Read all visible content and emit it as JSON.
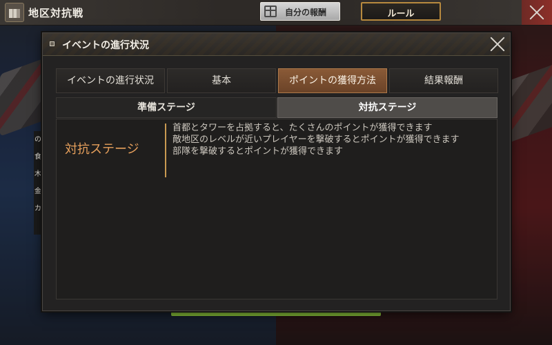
{
  "topbar": {
    "title": "地区対抗戦",
    "reward_button": "自分の報酬",
    "rule_button": "ルール",
    "icons": {
      "event": "building-icon",
      "gift": "gift-icon",
      "close": "close-icon"
    }
  },
  "background": {
    "side_labels": [
      "の",
      "食",
      "木",
      "金",
      "カ"
    ]
  },
  "modal": {
    "title": "イベントの進行状況",
    "tabs": [
      {
        "label": "イベントの進行状況",
        "active": false
      },
      {
        "label": "基本",
        "active": false
      },
      {
        "label": "ポイントの獲得方法",
        "active": true
      },
      {
        "label": "結果報酬",
        "active": false
      }
    ],
    "subtabs": [
      {
        "label": "準備ステージ",
        "active": false
      },
      {
        "label": "対抗ステージ",
        "active": true
      }
    ],
    "content": {
      "stage_label": "対抗ステージ",
      "lines": [
        "首都とタワーを占拠すると、たくさんのポイントが獲得できます",
        "敵地区のレベルが近いプレイヤーを撃破するとポイントが獲得できます",
        "部隊を撃破するとポイントが獲得できます"
      ]
    }
  },
  "colors": {
    "accent_orange": "#e7a05c",
    "active_tab": "#7a4e30",
    "progress_green": "#8ac23b",
    "left_team": "#2a4877",
    "right_team": "#7d2226"
  }
}
